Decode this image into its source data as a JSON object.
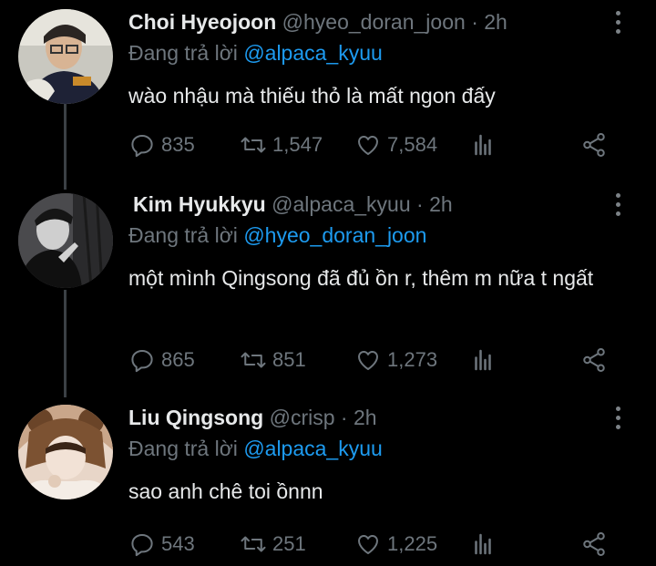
{
  "tweets": [
    {
      "name": "Choi Hyeojoon",
      "handle": "@hyeo_doran_joon",
      "time": "2h",
      "reply_prefix": "Đang trả lời",
      "reply_to": "@alpaca_kyuu",
      "text": "wào nhậu mà thiếu thỏ là mất ngon đấy",
      "replies": "835",
      "retweets": "1,547",
      "likes": "7,584"
    },
    {
      "name": "Kim Hyukkyu",
      "handle": "@alpaca_kyuu",
      "time": "2h",
      "reply_prefix": "Đang trả lời",
      "reply_to": "@hyeo_doran_joon",
      "text": "một mình Qingsong đã đủ ồn r, thêm m nữa t ngất",
      "replies": "865",
      "retweets": "851",
      "likes": "1,273"
    },
    {
      "name": "Liu Qingsong",
      "handle": "@crisp",
      "time": "2h",
      "reply_prefix": "Đang trả lời",
      "reply_to": "@alpaca_kyuu",
      "text": "sao anh chê toi ồnnn",
      "replies": "543",
      "retweets": "251",
      "likes": "1,225"
    }
  ],
  "icons": {
    "reply": "reply-icon",
    "retweet": "retweet-icon",
    "like": "heart-icon",
    "stats": "stats-icon",
    "share": "share-icon",
    "more": "more-icon"
  },
  "colors": {
    "background": "#000000",
    "text": "#e7e9ea",
    "muted": "#6e767d",
    "link": "#1d9bf0",
    "thread_line": "#3b4045"
  }
}
